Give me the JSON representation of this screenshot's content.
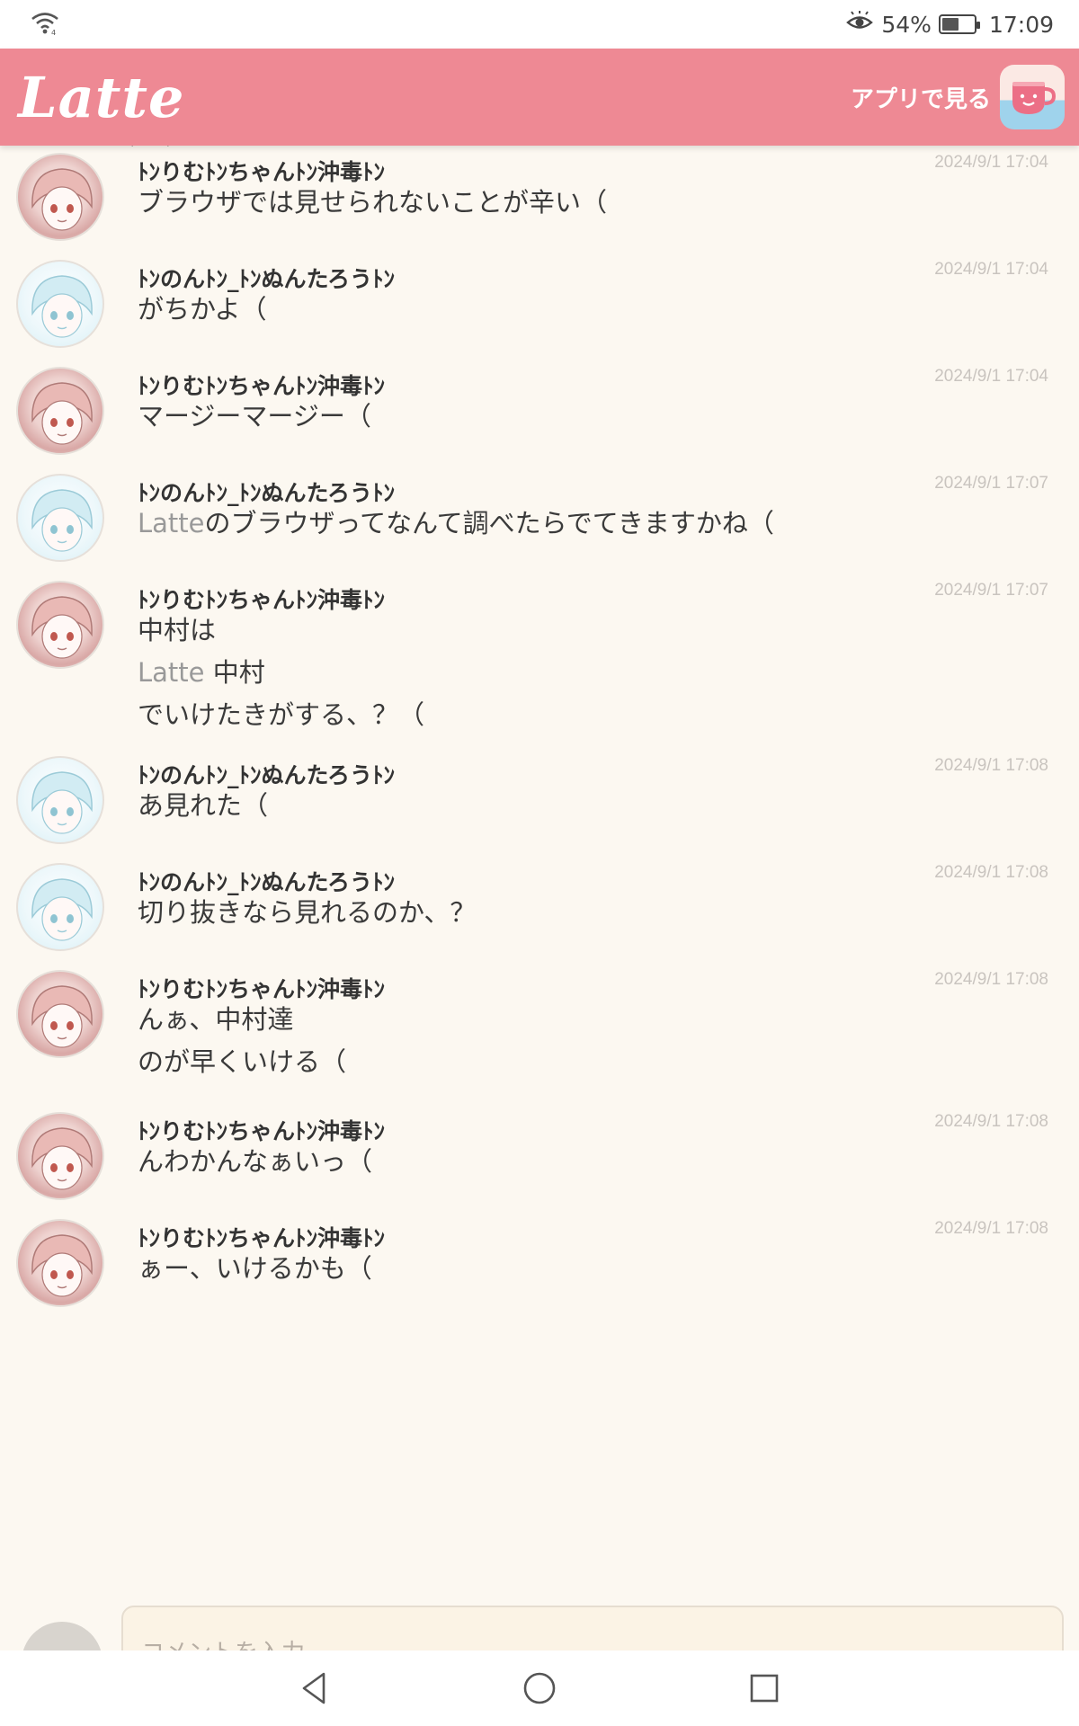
{
  "status_bar": {
    "battery_percent": "54%",
    "battery_level": 0.54,
    "time": "17:09",
    "icons": [
      "wifi-icon",
      "eye-icon",
      "battery-icon"
    ]
  },
  "header": {
    "logo": "Latte",
    "open_app_label": "アプリで見る",
    "app_icon": "coffee-cup-icon"
  },
  "messages": [
    {
      "user": "ﾄﾝりむﾄﾝちゃんﾄﾝ沖毒ﾄﾝ",
      "avatar": "rimu",
      "time": "2024/9/1 17:04",
      "lines": [
        [
          {
            "t": "ブラウザでは見せられないことが辛い（"
          }
        ]
      ]
    },
    {
      "user": "ﾄﾝのんﾄﾝ_ﾄﾝぬんたろうﾄﾝ",
      "avatar": "non",
      "time": "2024/9/1 17:04",
      "lines": [
        [
          {
            "t": "がちかよ（"
          }
        ]
      ]
    },
    {
      "user": "ﾄﾝりむﾄﾝちゃんﾄﾝ沖毒ﾄﾝ",
      "avatar": "rimu",
      "time": "2024/9/1 17:04",
      "lines": [
        [
          {
            "t": "マージーマージー（"
          }
        ]
      ]
    },
    {
      "user": "ﾄﾝのんﾄﾝ_ﾄﾝぬんたろうﾄﾝ",
      "avatar": "non",
      "time": "2024/9/1 17:07",
      "lines": [
        [
          {
            "t": "Latte",
            "light": true
          },
          {
            "t": "のブラウザってなんて調べたらでてきますかね（"
          }
        ]
      ]
    },
    {
      "user": "ﾄﾝりむﾄﾝちゃんﾄﾝ沖毒ﾄﾝ",
      "avatar": "rimu",
      "time": "2024/9/1 17:07",
      "lines": [
        [
          {
            "t": "中村は"
          }
        ],
        [
          {
            "t": "Latte ",
            "light": true
          },
          {
            "t": "中村"
          }
        ],
        [
          {
            "t": "でいけたきがする、？（"
          }
        ]
      ]
    },
    {
      "user": "ﾄﾝのんﾄﾝ_ﾄﾝぬんたろうﾄﾝ",
      "avatar": "non",
      "time": "2024/9/1 17:08",
      "lines": [
        [
          {
            "t": "あ見れた（"
          }
        ]
      ]
    },
    {
      "user": "ﾄﾝのんﾄﾝ_ﾄﾝぬんたろうﾄﾝ",
      "avatar": "non",
      "time": "2024/9/1 17:08",
      "lines": [
        [
          {
            "t": "切り抜きなら見れるのか、？"
          }
        ]
      ]
    },
    {
      "user": "ﾄﾝりむﾄﾝちゃんﾄﾝ沖毒ﾄﾝ",
      "avatar": "rimu",
      "time": "2024/9/1 17:08",
      "lines": [
        [
          {
            "t": "んぁ、中村達"
          }
        ],
        [
          {
            "t": "のが早くいける（"
          }
        ]
      ]
    },
    {
      "user": "ﾄﾝりむﾄﾝちゃんﾄﾝ沖毒ﾄﾝ",
      "avatar": "rimu",
      "time": "2024/9/1 17:08",
      "lines": [
        [
          {
            "t": "んわかんなぁいっ（"
          }
        ]
      ]
    },
    {
      "user": "ﾄﾝりむﾄﾝちゃんﾄﾝ沖毒ﾄﾝ",
      "avatar": "rimu",
      "time": "2024/9/1 17:08",
      "lines": [
        [
          {
            "t": "ぁー、いけるかも（"
          }
        ]
      ]
    }
  ],
  "comment": {
    "placeholder": "コメントを入力"
  },
  "nav": {
    "buttons": [
      "back-icon",
      "home-icon",
      "recents-icon"
    ]
  },
  "colors": {
    "header": "#ee8994",
    "background": "#fcf8f1",
    "timestamp": "#c9c4bf"
  }
}
